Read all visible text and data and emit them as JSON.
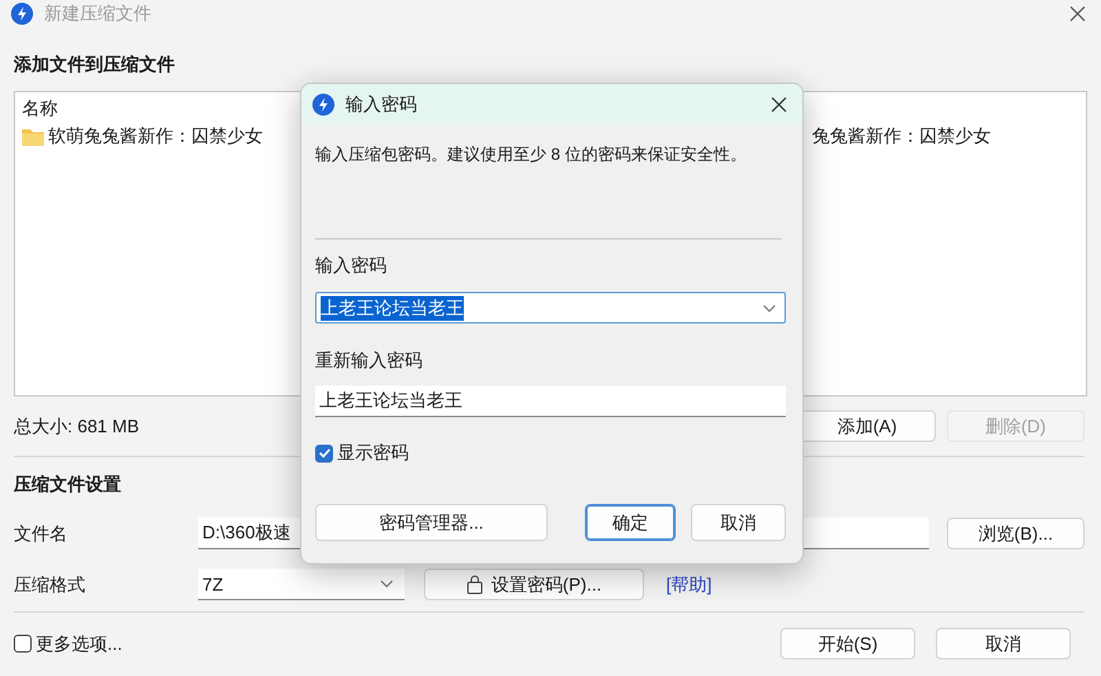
{
  "window": {
    "title": "新建压缩文件"
  },
  "files_section": {
    "heading": "添加文件到压缩文件",
    "columns": [
      "名称"
    ],
    "rows": [
      {
        "name": "软萌兔兔酱新作：囚禁少女",
        "column_2": "兔兔酱新作：囚禁少女"
      }
    ],
    "total_size": "总大小: 681 MB",
    "buttons": [
      {
        "label": "添加(A)",
        "disabled": false
      },
      {
        "label": "删除(D)",
        "disabled": true
      }
    ]
  },
  "settings": {
    "heading": "压缩文件设置",
    "filename_label": "文件名",
    "filename_value": "D:\\360极速",
    "browse_button": "浏览(B)...",
    "format_label": "压缩格式",
    "format_value": "7Z",
    "password_button": "设置密码(P)...",
    "help_link": "[帮助]"
  },
  "footer": {
    "more_options": {
      "label": "更多选项...",
      "checked": false
    },
    "buttons": [
      {
        "label": "开始(S)"
      },
      {
        "label": "取消"
      }
    ]
  },
  "dialog": {
    "title": "输入密码",
    "description": "输入压缩包密码。建议使用至少 8 位的密码来保证安全性。",
    "password_label": "输入密码",
    "password_value": "上老王论坛当老王",
    "password_text_selected": true,
    "confirm_label": "重新输入密码",
    "confirm_value": "上老王论坛当老王",
    "show_password": {
      "label": "显示密码",
      "checked": true
    },
    "buttons": [
      {
        "label": "密码管理器...",
        "default": false
      },
      {
        "label": "确定",
        "default": true
      },
      {
        "label": "取消",
        "default": false
      }
    ]
  }
}
